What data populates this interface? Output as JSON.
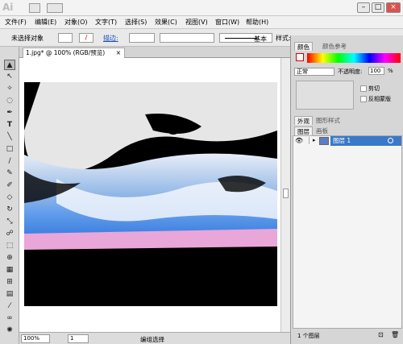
{
  "app": {
    "logo": "Ai"
  },
  "menu": [
    "文件(F)",
    "编辑(E)",
    "对象(O)",
    "文字(T)",
    "选择(S)",
    "效果(C)",
    "视图(V)",
    "窗口(W)",
    "帮助(H)"
  ],
  "control": {
    "selection": "未选择对象",
    "stroke_label": "描边:",
    "style_label": "基本",
    "style_kind_label": "样式:"
  },
  "document": {
    "tab_title": "1.jpg* @ 100% (RGB/预览)"
  },
  "status": {
    "zoom": "100%",
    "page": "1",
    "mode": "编组选择"
  },
  "panels": {
    "color_tabs": [
      "颜色",
      "颜色参考"
    ],
    "blend_mode": "正常",
    "opacity_label": "不透明度:",
    "opacity_value": "100",
    "opacity_unit": "%",
    "clip_label": "剪切",
    "invert_label": "反相蒙版",
    "appearance_tabs": [
      "外观",
      "图形样式"
    ],
    "layer_tabs": [
      "图层",
      "画板"
    ],
    "layer_name": "图层 1",
    "layer_count": "1 个图层"
  },
  "colors": {
    "layer_highlight": "#3a78c8",
    "title_bg": "#f3f3f3",
    "panel_bg": "#d6d6d6"
  }
}
